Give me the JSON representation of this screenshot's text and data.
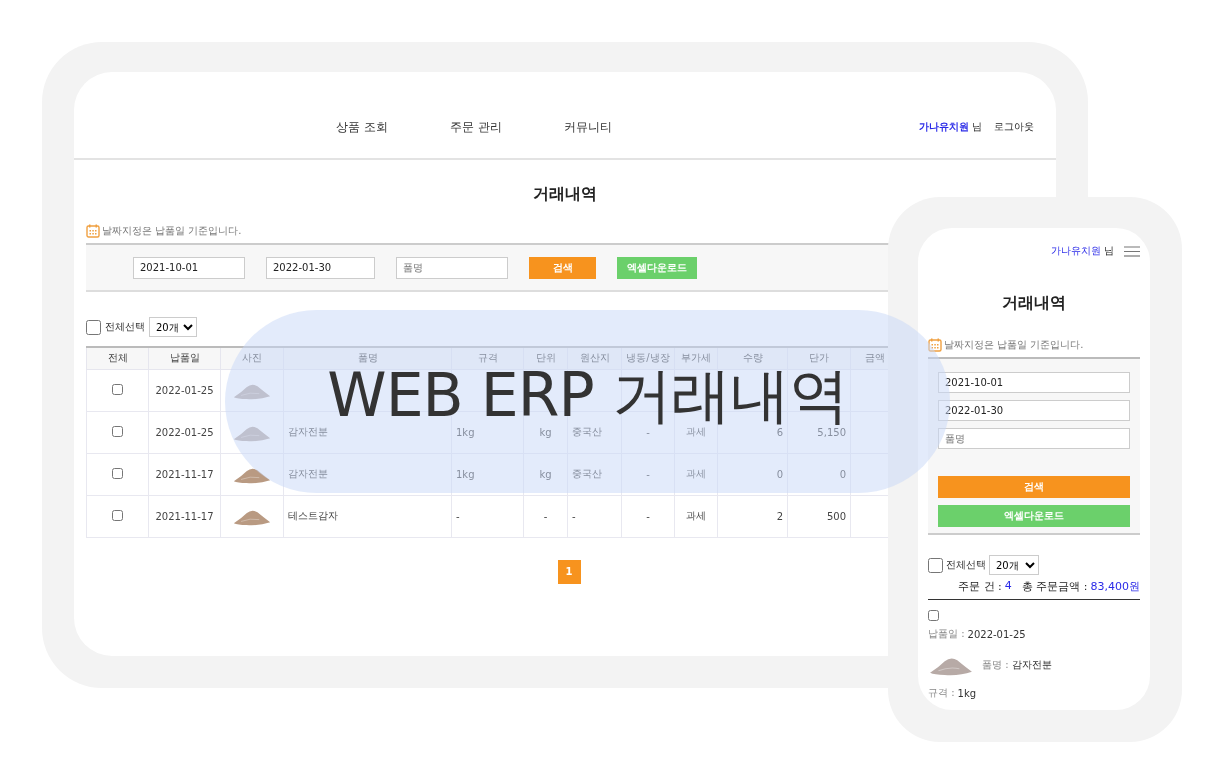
{
  "tablet": {
    "nav": [
      {
        "label": "상품 조회"
      },
      {
        "label": "주문 관리"
      },
      {
        "label": "커뮤니티"
      }
    ],
    "user": {
      "name": "가나유치원",
      "suffix": "님"
    },
    "logout": "로그아웃",
    "title": "거래내역",
    "notice": "날짜지정은 납품일 기준입니다.",
    "search": {
      "date_from": "2021-10-01",
      "date_to": "2022-01-30",
      "product_placeholder": "품명",
      "search_button": "검색",
      "excel_button": "엑셀다운로드"
    },
    "select_all": {
      "label": "전체선택",
      "checked": false
    },
    "page_size": "20개",
    "table": {
      "columns": [
        "전체",
        "납품일",
        "사진",
        "품명",
        "규격",
        "단위",
        "원산지",
        "냉동/냉장",
        "부가세",
        "수량",
        "단가",
        "금액"
      ],
      "rows": [
        {
          "checked": false,
          "date": "2022-01-25"
        },
        {
          "checked": false,
          "date": "2022-01-25",
          "product": "감자전분",
          "spec": "1kg",
          "unit": "kg",
          "origin": "중국산",
          "storage": "-",
          "vat": "과세",
          "quantity": "6",
          "unit_price": "5,150"
        },
        {
          "checked": false,
          "date": "2021-11-17",
          "product": "감자전분",
          "spec": "1kg",
          "unit": "kg",
          "origin": "중국산",
          "storage": "-",
          "vat": "과세",
          "quantity": "0",
          "unit_price": "0"
        },
        {
          "checked": false,
          "date": "2021-11-17",
          "product": "테스트감자",
          "spec": "-",
          "unit": "-",
          "origin": "-",
          "storage": "-",
          "vat": "과세",
          "quantity": "2",
          "unit_price": "500"
        }
      ]
    },
    "pagination": [
      {
        "label": "1",
        "selected": true
      }
    ]
  },
  "phone": {
    "user": {
      "name": "가나유치원",
      "suffix": "님"
    },
    "title": "거래내역",
    "notice": "날짜지정은 납품일 기준입니다.",
    "search": {
      "date_from": "2021-10-01",
      "date_to": "2022-01-30",
      "product_placeholder": "품명",
      "search_button": "검색",
      "excel_button": "엑셀다운로드"
    },
    "select_all": {
      "label": "전체선택",
      "checked": false
    },
    "page_size": "20개",
    "summary": {
      "count_label": "주문 건 :",
      "count": "4",
      "total_label": "총 주문금액 :",
      "total": "83,400원"
    },
    "item": {
      "checked": false,
      "date_label": "납품일 :",
      "date": "2022-01-25",
      "name_label": "품명 :",
      "name": "감자전분",
      "spec_label": "규격 :",
      "spec": "1kg"
    }
  },
  "banner": {
    "title": "WEB ERP 거래내역"
  }
}
